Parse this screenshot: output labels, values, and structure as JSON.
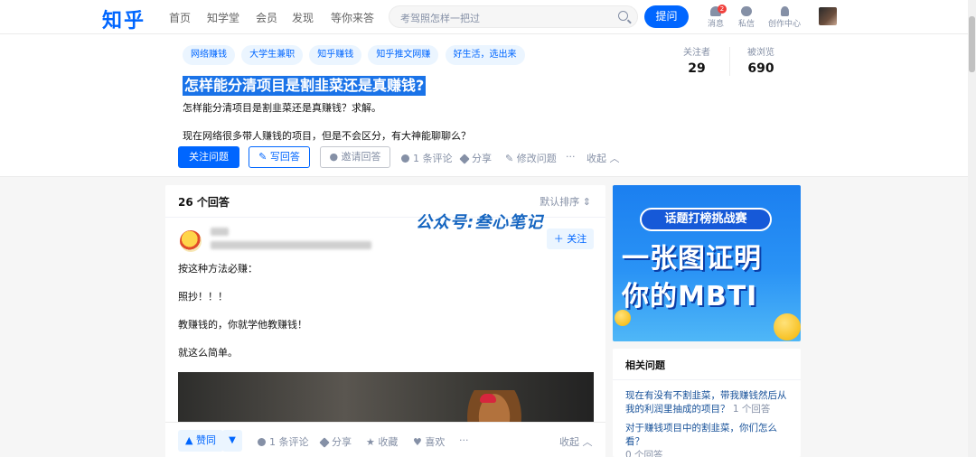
{
  "brand": {
    "logo": "知乎",
    "color": "#0066ff"
  },
  "nav": [
    "首页",
    "知学堂",
    "会员",
    "发现",
    "等你来答"
  ],
  "search": {
    "placeholder": "考驾照怎样一把过"
  },
  "ask_label": "提问",
  "top_icons": [
    {
      "label": "消息",
      "icon": "bell-icon",
      "badge": "2"
    },
    {
      "label": "私信",
      "icon": "chat-icon"
    },
    {
      "label": "创作中心",
      "icon": "creator-icon"
    }
  ],
  "question": {
    "tags": [
      "网络赚钱",
      "大学生兼职",
      "知乎赚钱",
      "知乎推文网赚",
      "好生活，选出来"
    ],
    "title": "怎样能分清项目是割韭菜还是真赚钱?",
    "desc_line1": "怎样能分清项目是割韭菜还是真赚钱？求解。",
    "desc_line2": "现在网络很多带人赚钱的项目，但是不会区分，有大神能聊聊么？",
    "followers_label": "关注者",
    "followers": "29",
    "views_label": "被浏览",
    "views": "690",
    "actions": {
      "follow": "关注问题",
      "write": "写回答",
      "invite": "邀请回答",
      "comments": "1 条评论",
      "share": "分享",
      "edit": "修改问题",
      "more": "···",
      "collapse": "收起"
    }
  },
  "answers": {
    "count_label": "26 个回答",
    "sort_label": "默认排序",
    "follow_label": "关注",
    "lines": [
      "按这种方法必赚：",
      "照抄！！！",
      "教赚钱的，你就学他教赚钱！",
      "就这么简单。"
    ],
    "watermark": "公众号:叁心笔记",
    "bar": {
      "upvote": "赞同",
      "comments": "1 条评论",
      "share": "分享",
      "collect": "收藏",
      "like": "喜欢",
      "more": "···",
      "collapse": "收起"
    }
  },
  "banner": {
    "pill": "话题打榜挑战赛",
    "line1": "一张图证明",
    "line2": "你的MBTI"
  },
  "related": {
    "title": "相关问题",
    "items": [
      {
        "q": "现在有没有不割韭菜，带我赚钱然后从我的利润里抽成的项目？",
        "count": "1 个回答"
      },
      {
        "q": "对于赚钱项目中的割韭菜，你们怎么看？",
        "count": "0 个回答"
      }
    ]
  }
}
